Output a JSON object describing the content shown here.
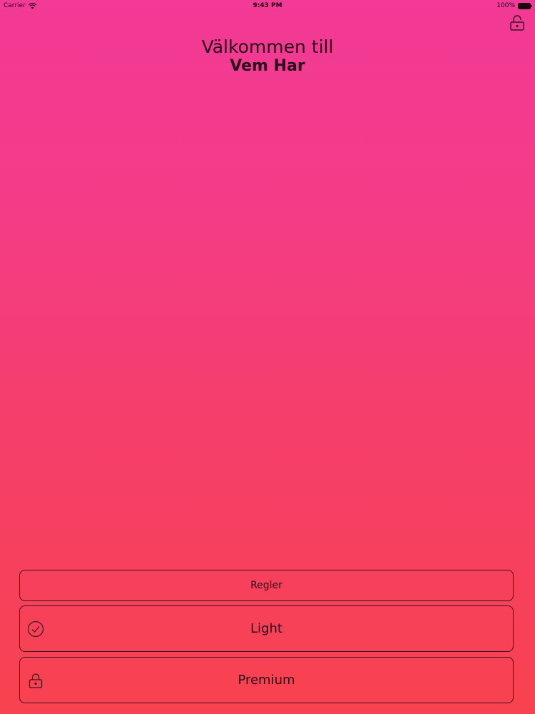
{
  "status_bar": {
    "carrier": "Carrier",
    "time": "9:43 PM",
    "battery": "100%",
    "icons": [
      "wifi-icon",
      "battery-icon"
    ]
  },
  "header": {
    "lock_icon": "lock-icon"
  },
  "title": {
    "line1": "Välkommen till",
    "line2": "Vem Har"
  },
  "buttons": {
    "rules_label": "Regler",
    "light_label": "Light",
    "light_icon": "check-circle-icon",
    "premium_label": "Premium",
    "premium_icon": "lock-icon"
  },
  "colors": {
    "gradient_top": "#f23a96",
    "gradient_bottom": "#f8424f",
    "text": "#2a0f1a"
  }
}
